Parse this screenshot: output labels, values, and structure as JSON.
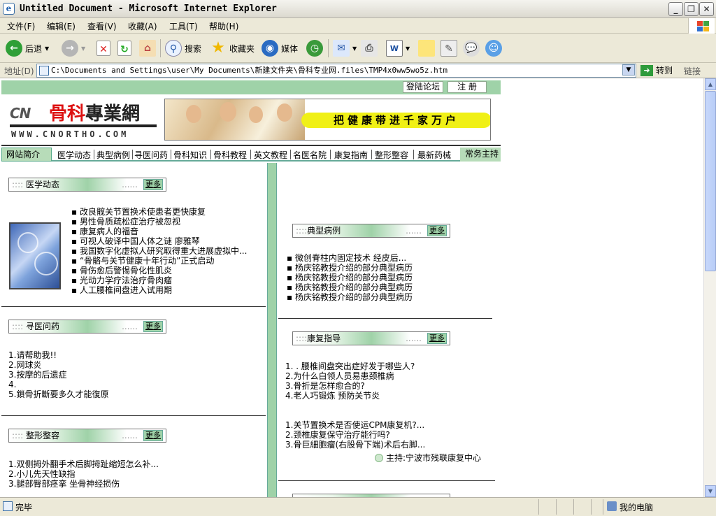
{
  "window": {
    "title": "Untitled Document - Microsoft Internet Explorer"
  },
  "menu": [
    "文件(F)",
    "编辑(E)",
    "查看(V)",
    "收藏(A)",
    "工具(T)",
    "帮助(H)"
  ],
  "toolbar": {
    "back": "后退",
    "search": "搜索",
    "favorites": "收藏夹",
    "media": "媒体"
  },
  "address": {
    "label": "地址(D)",
    "url": "C:\\Documents and Settings\\user\\My Documents\\新建文件夹\\骨科专业网.files\\TMP4x0ww5wo5z.htm",
    "go": "转到",
    "links": "链接"
  },
  "status": {
    "text": "完毕",
    "zone": "我的电脑"
  },
  "page": {
    "login": "登陆论坛",
    "register": "注 册",
    "logo_cn": "CN",
    "logo_main_red": "骨科",
    "logo_main_black": "專業網",
    "logo_url": "WWW.CNORTHO.COM",
    "slogan": "把健康带进千家万户",
    "nav_first": "网站简介",
    "nav_items": [
      "医学动态",
      "典型病例",
      "寻医问药",
      "骨科知识",
      "骨科教程",
      "英文教程",
      "名医名院",
      "康复指南",
      "整形整容",
      "最新药械"
    ],
    "nav_last": "常务主持",
    "more_label": "更多",
    "left": {
      "news": {
        "title": "医学动态",
        "items": [
          "改良髋关节置换术使患者更快康复",
          "男性骨质疏松症治疗被忽视",
          "康复病人的福音",
          "可视人破译中国人体之谜  廖雅琴",
          "我国数字化虚拟人研究取得重大进展虚拟中...",
          "“骨骼与关节健康十年行动”正式启动",
          "骨伤愈后警惕骨化性肌炎",
          "光动力学疗法治疗骨肉瘤",
          "人工腰椎间盘进入试用期"
        ]
      },
      "consult": {
        "title": "寻医问药",
        "items": [
          "1.请帮助我!!",
          "2.网球炎",
          "3.按摩的后遗症",
          "4.",
          "5.鎖骨折斷要多久才能復原"
        ]
      },
      "plastic": {
        "title": "整形整容",
        "items": [
          "1.双侧拇外翻手术后脚拇趾缩短怎么补...",
          "2.小儿先天性缺指",
          "3.腿部臀部痉挛 坐骨神经损伤"
        ]
      }
    },
    "right": {
      "cases": {
        "title": "典型病例",
        "items": [
          "微创脊柱内固定技术  经皮后...",
          "杨庆铭教授介绍的部分典型病历",
          "杨庆铭教授介绍的部分典型病历",
          "杨庆铭教授介绍的部分典型病历",
          "杨庆铭教授介绍的部分典型病历"
        ]
      },
      "rehab": {
        "title": "康复指导",
        "items_a": [
          "1. .  腰椎间盘突出症好发于哪些人?",
          "2.为什么白领人员易患颈椎病",
          "3.骨折是怎样愈合的?",
          "4.老人巧锻炼  预防关节炎"
        ],
        "items_b": [
          "1.关节置换术是否使运CPM康复机?...",
          "2.颈椎康复保守治疗能行吗?",
          "3.骨巨細胞瘤(右股骨下端)术后右脚..."
        ],
        "host": "主持:宁波市残联康复中心"
      }
    }
  }
}
